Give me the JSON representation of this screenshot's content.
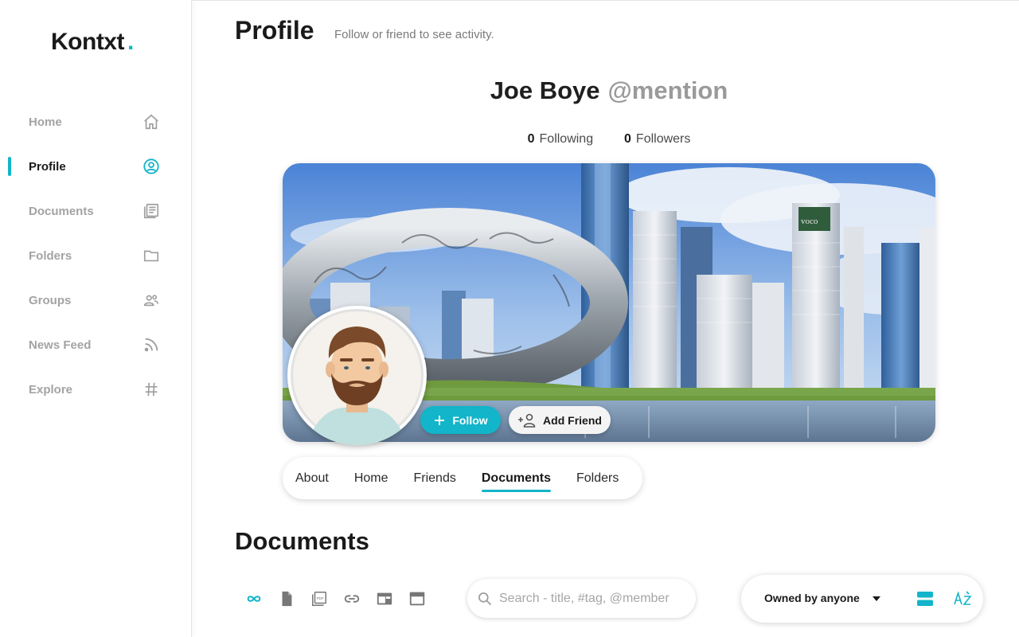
{
  "app": {
    "name": "Kontxt",
    "dot": ".",
    "accent": "#12b5c9"
  },
  "sidebar": {
    "items": [
      {
        "label": "Home",
        "icon": "home-icon",
        "active": false
      },
      {
        "label": "Profile",
        "icon": "user-circle-icon",
        "active": true
      },
      {
        "label": "Documents",
        "icon": "documents-icon",
        "active": false
      },
      {
        "label": "Folders",
        "icon": "folder-icon",
        "active": false
      },
      {
        "label": "Groups",
        "icon": "group-icon",
        "active": false
      },
      {
        "label": "News Feed",
        "icon": "rss-icon",
        "active": false
      },
      {
        "label": "Explore",
        "icon": "hashtag-icon",
        "active": false
      }
    ]
  },
  "header": {
    "title": "Profile",
    "subtitle": "Follow or friend to see activity."
  },
  "profile": {
    "name": "Joe Boye",
    "handle": "@mention",
    "following_count": "0",
    "following_label": "Following",
    "followers_count": "0",
    "followers_label": "Followers",
    "follow_label": "Follow",
    "add_friend_label": "Add Friend"
  },
  "tabs": [
    {
      "label": "About",
      "active": false
    },
    {
      "label": "Home",
      "active": false
    },
    {
      "label": "Friends",
      "active": false
    },
    {
      "label": "Documents",
      "active": true
    },
    {
      "label": "Folders",
      "active": false
    }
  ],
  "documents": {
    "title": "Documents",
    "type_filters": [
      "infinity-icon",
      "file-icon",
      "pdf-icon",
      "link-icon",
      "web-icon",
      "window-icon"
    ],
    "search_placeholder": "Search - title, #tag, @member",
    "owner_filter": "Owned by anyone"
  }
}
